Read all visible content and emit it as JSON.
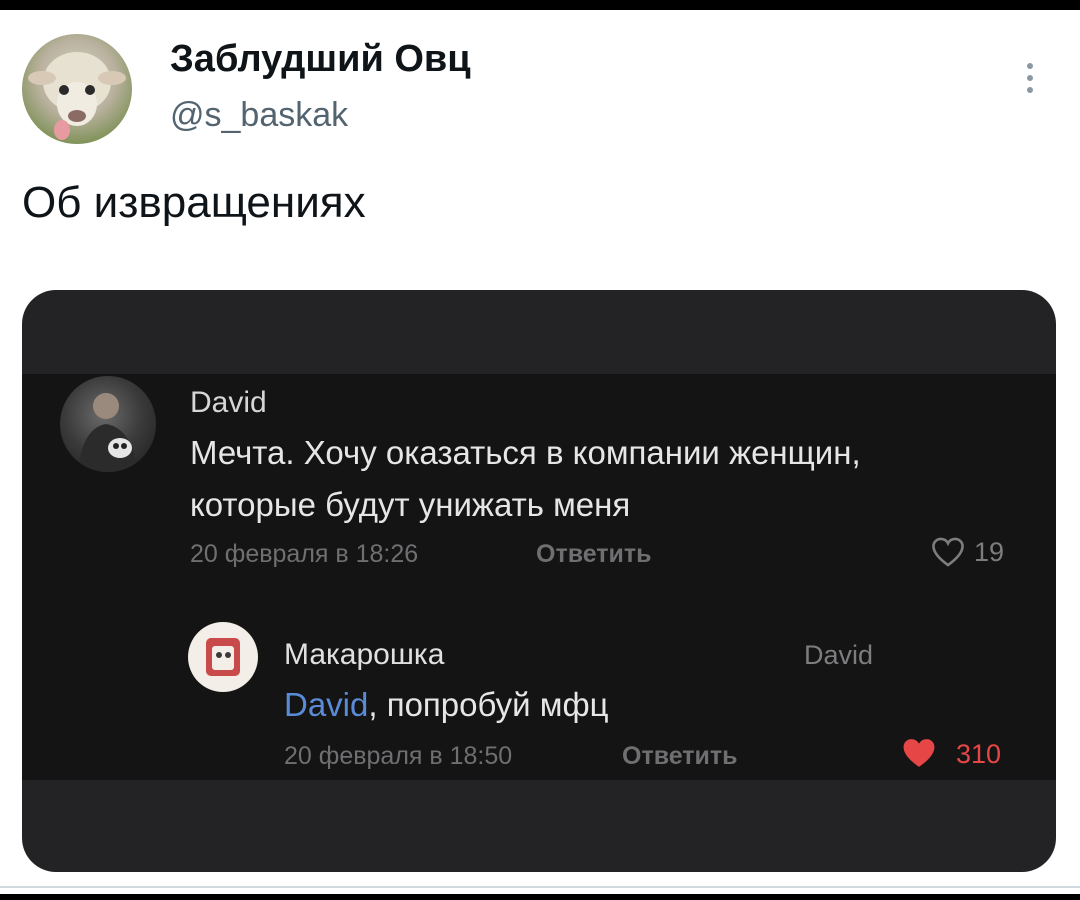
{
  "tweet": {
    "author_name": "Заблудший Овц",
    "author_handle": "@s_baskak",
    "text": "Об извращениях"
  },
  "screenshot": {
    "comment": {
      "author": "David",
      "text_line1": "Мечта. Хочу оказаться в компании женщин,",
      "text_line2": "которые будут унижать меня",
      "timestamp": "20 февраля в 18:26",
      "reply_label": "Ответить",
      "likes": "19",
      "liked": false
    },
    "reply": {
      "author": "Макарошка",
      "reply_to": "David",
      "mention": "David",
      "text": ", попробуй мфц",
      "timestamp": "20 февраля в 18:50",
      "reply_label": "Ответить",
      "likes": "310",
      "liked": true
    }
  },
  "colors": {
    "like_active": "#e64646",
    "mention": "#5b8bd6",
    "muted": "#6f6f72"
  },
  "icons": {
    "more": "more-vertical-icon",
    "like_empty": "heart-outline-icon",
    "like_filled": "heart-filled-icon"
  }
}
